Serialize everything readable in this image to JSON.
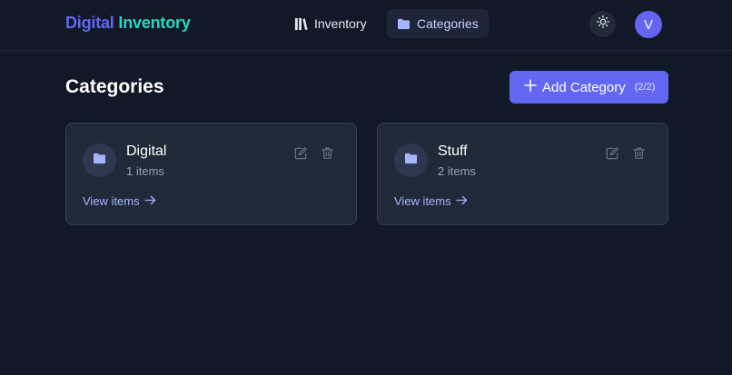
{
  "brand": {
    "part1": "Digital",
    "part2": "Inventory"
  },
  "nav": {
    "inventory_label": "Inventory",
    "categories_label": "Categories",
    "active": "Categories"
  },
  "header": {
    "avatar_initial": "V"
  },
  "page": {
    "title": "Categories",
    "add_button_label": "Add Category",
    "add_button_count": "(2/2)"
  },
  "categories": [
    {
      "name": "Digital",
      "count_text": "1 items",
      "view_label": "View items"
    },
    {
      "name": "Stuff",
      "count_text": "2 items",
      "view_label": "View items"
    }
  ],
  "icons": {
    "nav_inventory": "library-icon",
    "nav_categories": "folder-icon",
    "theme": "sun-icon",
    "add": "plus-icon",
    "card_folder": "folder-icon",
    "edit": "pencil-icon",
    "delete": "trash-icon",
    "view": "arrow-right-icon"
  },
  "colors": {
    "background": "#111827",
    "accent": "#6366f1",
    "brand_secondary": "#2dd4bf",
    "card": "#1f2937",
    "link": "#a5b4fc"
  }
}
